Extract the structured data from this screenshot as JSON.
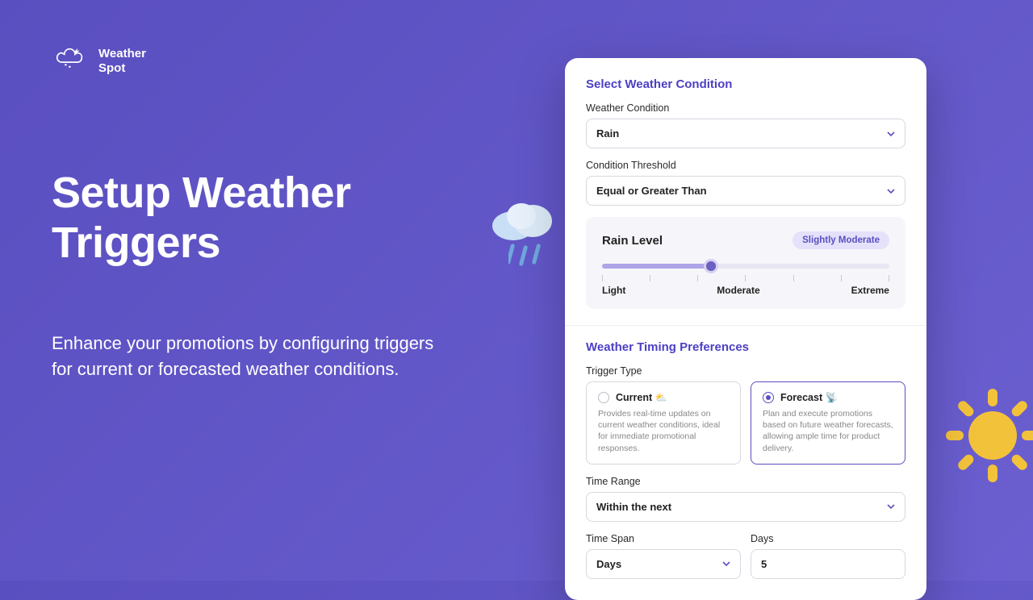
{
  "brand": {
    "line1": "Weather",
    "line2": "Spot"
  },
  "hero": {
    "title_l1": "Setup Weather",
    "title_l2": "Triggers",
    "sub_l1": "Enhance your promotions by configuring triggers",
    "sub_l2": "for current or forecasted weather conditions."
  },
  "card": {
    "section1_title": "Select Weather Condition",
    "weather_condition_label": "Weather Condition",
    "weather_condition_value": "Rain",
    "condition_threshold_label": "Condition Threshold",
    "condition_threshold_value": "Equal or Greater Than",
    "slider": {
      "title": "Rain Level",
      "badge": "Slightly Moderate",
      "min_label": "Light",
      "mid_label": "Moderate",
      "max_label": "Extreme",
      "fill_percent": 38
    },
    "section2_title": "Weather Timing Preferences",
    "trigger_type_label": "Trigger Type",
    "trigger_options": [
      {
        "label": "Current",
        "emoji": "⛅",
        "desc": "Provides real-time updates on current weather conditions, ideal for immediate promotional responses.",
        "selected": false
      },
      {
        "label": "Forecast",
        "emoji": "📡",
        "desc": "Plan and execute promotions based on future weather forecasts, allowing ample time for product delivery.",
        "selected": true
      }
    ],
    "time_range_label": "Time Range",
    "time_range_value": "Within the next",
    "time_span_label": "Time Span",
    "time_span_value": "Days",
    "days_label": "Days",
    "days_value": "5"
  },
  "colors": {
    "accent": "#5a4fc0"
  }
}
